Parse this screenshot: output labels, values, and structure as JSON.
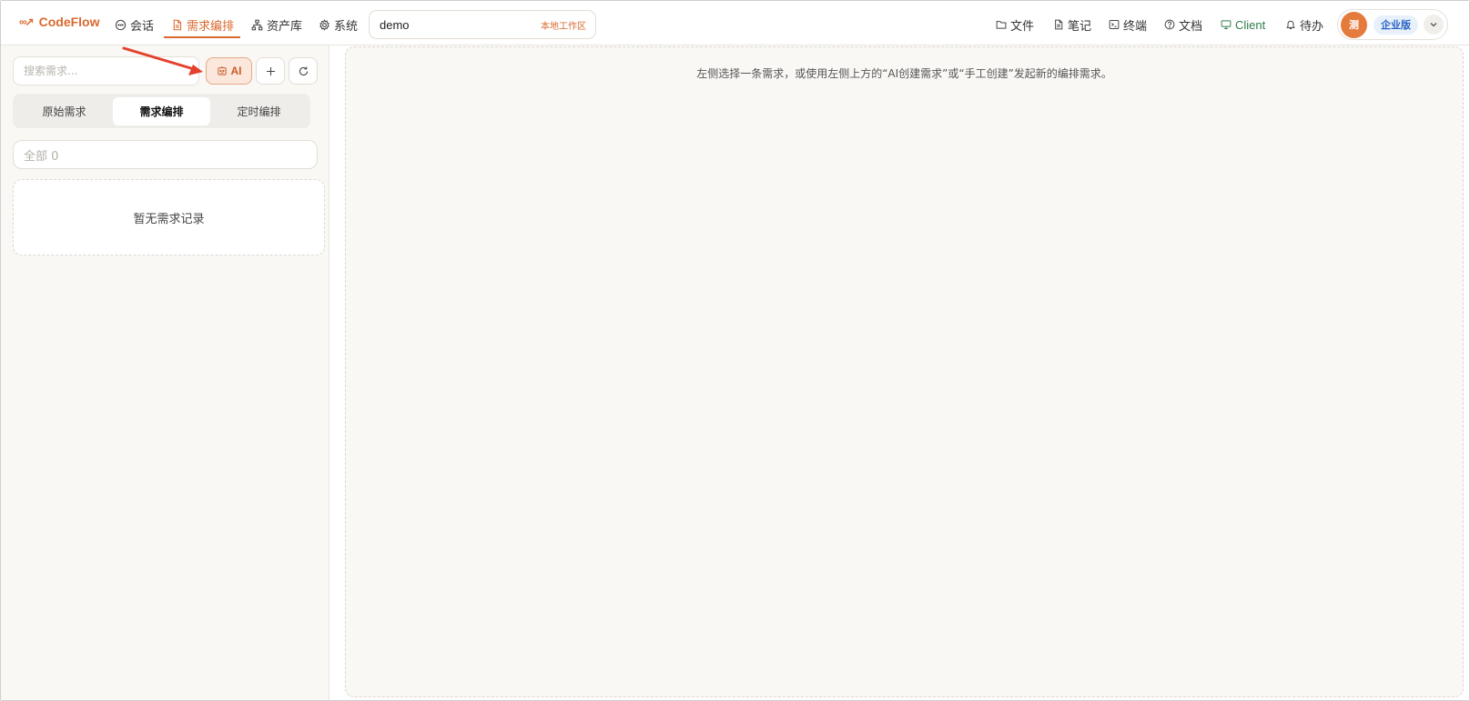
{
  "app": {
    "logo_text": "CodeFlow",
    "logo_mark": "∞↗"
  },
  "nav": {
    "items": [
      {
        "label": "会话",
        "icon": "chat-icon"
      },
      {
        "label": "需求编排",
        "icon": "document-icon",
        "active": true
      },
      {
        "label": "资产库",
        "icon": "hierarchy-icon"
      },
      {
        "label": "系统",
        "icon": "gear-icon"
      }
    ]
  },
  "workspace": {
    "name": "demo",
    "tag": "本地工作区"
  },
  "right_nav": {
    "items": [
      {
        "label": "文件",
        "icon": "folder-icon"
      },
      {
        "label": "笔记",
        "icon": "note-icon"
      },
      {
        "label": "终端",
        "icon": "terminal-icon"
      },
      {
        "label": "文档",
        "icon": "help-icon"
      },
      {
        "label": "Client",
        "icon": "monitor-icon"
      },
      {
        "label": "待办",
        "icon": "bell-icon"
      }
    ]
  },
  "user": {
    "avatar_text": "测",
    "edition": "企业版"
  },
  "sidebar": {
    "search_placeholder": "搜索需求...",
    "ai_button": "AI",
    "tabs": [
      {
        "label": "原始需求"
      },
      {
        "label": "需求编排",
        "active": true
      },
      {
        "label": "定时编排"
      }
    ],
    "filter_label": "全部 0",
    "empty_text": "暂无需求记录"
  },
  "main": {
    "hint": "左侧选择一条需求，或使用左侧上方的“AI创建需求”或“手工创建”发起新的编排需求。"
  },
  "colors": {
    "accent": "#d9692f",
    "annotation_arrow": "#e5402b",
    "client_green": "#2f7d4a",
    "edition_blue": "#2b63c6"
  }
}
